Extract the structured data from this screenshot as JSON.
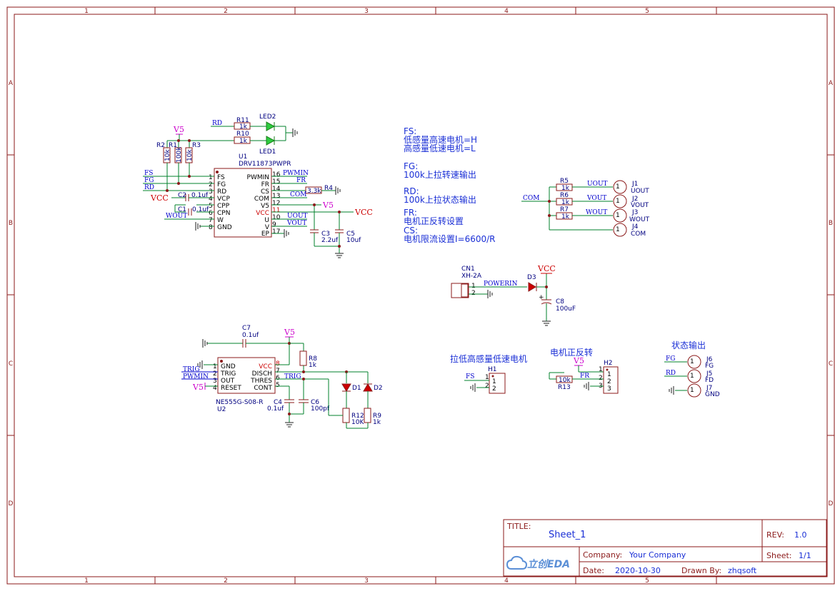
{
  "border": {
    "columns": [
      "1",
      "2",
      "3",
      "4",
      "5"
    ],
    "rows": [
      "A",
      "B",
      "C",
      "D"
    ]
  },
  "notes": [
    "FS:",
    "低感量高速电机=H",
    "高感量低速电机=L",
    "FG:",
    "100k上拉转速输出",
    "RD:",
    "100k上拉状态输出",
    "FR:",
    "电机正反转设置",
    "CS:",
    "电机限流设置I=6600/R"
  ],
  "section_titles": {
    "h1": "拉低高感量低速电机",
    "h2": "电机正反转",
    "status": "状态输出"
  },
  "u1": {
    "ref": "U1",
    "value": "DRV11873PWPR",
    "left_pins": [
      {
        "num": "1",
        "name": "FS"
      },
      {
        "num": "2",
        "name": "FG"
      },
      {
        "num": "3",
        "name": "RD"
      },
      {
        "num": "4",
        "name": "VCP"
      },
      {
        "num": "5",
        "name": "CPP"
      },
      {
        "num": "6",
        "name": "CPN"
      },
      {
        "num": "7",
        "name": "W"
      },
      {
        "num": "8",
        "name": "GND"
      }
    ],
    "right_pins": [
      {
        "num": "16",
        "name": "PWMIN"
      },
      {
        "num": "15",
        "name": "FR"
      },
      {
        "num": "14",
        "name": "CS"
      },
      {
        "num": "13",
        "name": "COM"
      },
      {
        "num": "12",
        "name": "V5"
      },
      {
        "num": "11",
        "name": "VCC"
      },
      {
        "num": "10",
        "name": "U"
      },
      {
        "num": "9",
        "name": "V"
      },
      {
        "num": "17",
        "name": "EP"
      }
    ]
  },
  "u2": {
    "ref": "U2",
    "value": "NE555G-S08-R",
    "left_pins": [
      {
        "num": "1",
        "name": "GND"
      },
      {
        "num": "2",
        "name": "TRIG"
      },
      {
        "num": "3",
        "name": "OUT"
      },
      {
        "num": "4",
        "name": "RESET"
      }
    ],
    "right_pins": [
      {
        "num": "8",
        "name": "VCC"
      },
      {
        "num": "7",
        "name": "DISCH"
      },
      {
        "num": "6",
        "name": "THRES"
      },
      {
        "num": "5",
        "name": "CONT"
      }
    ]
  },
  "components": {
    "r11": {
      "ref": "R11",
      "value": "1k"
    },
    "r10": {
      "ref": "R10",
      "value": "1k"
    },
    "led2": {
      "ref": "LED2"
    },
    "led1": {
      "ref": "LED1"
    },
    "r1": {
      "ref": "R1",
      "value": "100k"
    },
    "r2": {
      "ref": "R2",
      "value": "10k"
    },
    "r3": {
      "ref": "R3",
      "value": "10k"
    },
    "c2": {
      "ref": "C2",
      "value": "0.1uf"
    },
    "c1": {
      "ref": "C1",
      "value": "0.1uf"
    },
    "r4": {
      "ref": "R4",
      "value": "3.3k"
    },
    "c3": {
      "ref": "C3",
      "value": "2.2uf"
    },
    "c5": {
      "ref": "C5",
      "value": "10uf"
    },
    "r5": {
      "ref": "R5",
      "value": "1k"
    },
    "r6": {
      "ref": "R6",
      "value": "1k"
    },
    "r7": {
      "ref": "R7",
      "value": "1k"
    },
    "j1": {
      "ref": "J1",
      "net": "UOUT"
    },
    "j2": {
      "ref": "J2",
      "net": "VOUT"
    },
    "j3": {
      "ref": "J3",
      "net": "WOUT"
    },
    "j4": {
      "ref": "J4",
      "net": "COM"
    },
    "cn1": {
      "ref": "CN1",
      "value": "XH-2A"
    },
    "d3": {
      "ref": "D3"
    },
    "c8": {
      "ref": "C8",
      "value": "100uF"
    },
    "c7": {
      "ref": "C7",
      "value": "0.1uf"
    },
    "r8": {
      "ref": "R8",
      "value": "1k"
    },
    "c4": {
      "ref": "C4",
      "value": "0.1uf"
    },
    "c6": {
      "ref": "C6",
      "value": "100pf"
    },
    "d1": {
      "ref": "D1"
    },
    "d2": {
      "ref": "D2"
    },
    "r12": {
      "ref": "R12",
      "value": "10K"
    },
    "r9": {
      "ref": "R9",
      "value": "1k"
    },
    "h1": {
      "ref": "H1"
    },
    "h2": {
      "ref": "H2"
    },
    "r13": {
      "ref": "R13",
      "value": "10k"
    },
    "j6": {
      "ref": "J6",
      "net": "FG"
    },
    "j5": {
      "ref": "J5",
      "net": "FD"
    },
    "j7": {
      "ref": "J7",
      "net": "GND"
    }
  },
  "nets": {
    "rd": "RD",
    "fs": "FS",
    "fg": "FG",
    "vcc": "VCC",
    "v5": "V5",
    "wout": "WOUT",
    "pwmin": "PWMIN",
    "fr": "FR",
    "com": "COM",
    "uout": "UOUT",
    "vout": "VOUT",
    "powerin": "POWERIN",
    "trig": "TRIG"
  },
  "pin_numbers": {
    "one": "1",
    "two": "2",
    "three": "3"
  },
  "title_block": {
    "title_label": "TITLE:",
    "title": "Sheet_1",
    "rev_label": "REV:",
    "rev": "1.0",
    "company_label": "Company:",
    "company": "Your Company",
    "sheet_label": "Sheet:",
    "sheet": "1/1",
    "date_label": "Date:",
    "date": "2020-10-30",
    "drawn_label": "Drawn By:",
    "drawn_by": "zhqsoft",
    "logo_text": "立创EDA"
  },
  "colors": {
    "frame": "#8b1a1a",
    "wire": "#00802b",
    "net_label": "#0000cc",
    "power": "#cc0000",
    "v5": "#cc00cc",
    "note": "#1a2fd6"
  }
}
